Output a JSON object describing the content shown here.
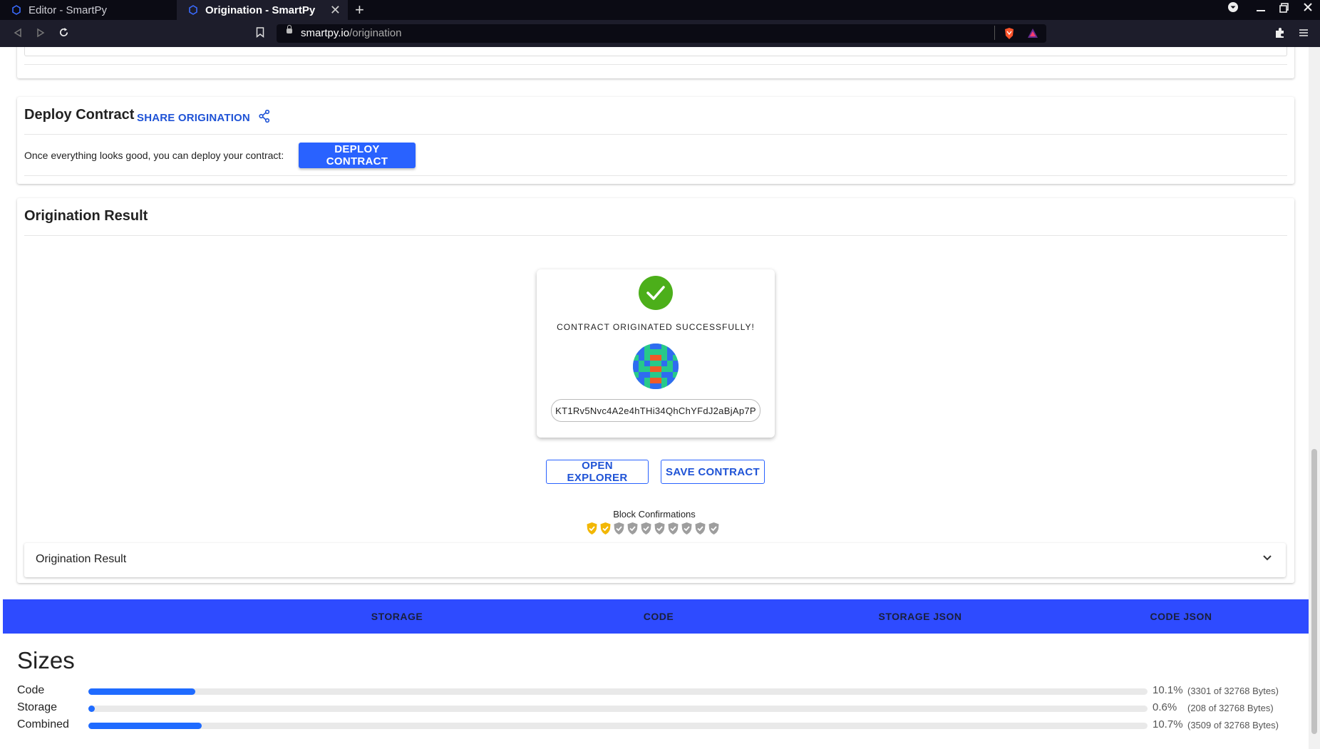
{
  "browser": {
    "tabs": [
      {
        "label": "Editor - SmartPy",
        "active": false
      },
      {
        "label": "Origination - SmartPy",
        "active": true
      }
    ],
    "url_host": "smartpy.io",
    "url_path": "/origination"
  },
  "deploy": {
    "title": "Deploy Contract",
    "share_label": "SHARE ORIGINATION",
    "prompt": "Once everything looks good, you can deploy your contract:",
    "deploy_button": "DEPLOY CONTRACT"
  },
  "result": {
    "title": "Origination Result",
    "success_text": "CONTRACT ORIGINATED SUCCESSFULLY!",
    "address": "KT1Rv5Nvc4A2e4hTHi34QhChYFdJ2aBjAp7P",
    "open_explorer": "OPEN EXPLORER",
    "save_contract": "SAVE CONTRACT",
    "confirmations_label": "Block Confirmations",
    "confirmations": {
      "confirmed": 2,
      "total": 10,
      "colors": {
        "confirmed": "#f2b705",
        "pending": "#9e9e9e"
      }
    },
    "accordion_label": "Origination Result"
  },
  "tabs": [
    "STORAGE",
    "CODE",
    "STORAGE JSON",
    "CODE JSON"
  ],
  "sizes": {
    "title": "Sizes",
    "rows": [
      {
        "label": "Code",
        "percent": "10.1%",
        "fraction": 0.101,
        "bytes": "(3301 of 32768 Bytes)"
      },
      {
        "label": "Storage",
        "percent": "0.6%",
        "fraction": 0.006,
        "bytes": "(208 of 32768 Bytes)"
      },
      {
        "label": "Combined",
        "percent": "10.7%",
        "fraction": 0.107,
        "bytes": "(3509 of 32768 Bytes)"
      }
    ]
  },
  "colors": {
    "primary": "#2962ff",
    "tab_bar": "#2e4bff",
    "success": "#4caf1a"
  }
}
